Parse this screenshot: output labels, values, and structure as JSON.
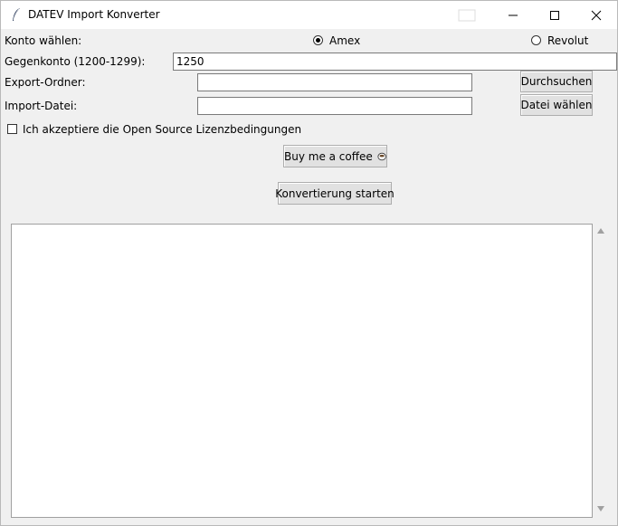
{
  "window": {
    "title": "DATEV Import Konverter",
    "controls": {
      "minimize": "–",
      "maximize": "□",
      "close": "✕"
    }
  },
  "form": {
    "konto_label": "Konto wählen:",
    "radio_amex": "Amex",
    "radio_revolut": "Revolut",
    "radio_selected": "Amex",
    "gegenkonto_label": "Gegenkonto (1200-1299):",
    "gegenkonto_value": "1250",
    "export_label": "Export-Ordner:",
    "export_value": "",
    "browse_button": "Durchsuchen",
    "import_label": "Import-Datei:",
    "import_value": "",
    "file_button": "Datei wählen",
    "license_label": "Ich akzeptiere die Open Source Lizenzbedingungen",
    "license_checked": false,
    "coffee_button": "Buy me a coffee",
    "convert_button": "Konvertierung starten"
  },
  "log": {
    "content": ""
  },
  "icons": {
    "title": "feather-icon",
    "coffee": "coffee-icon"
  }
}
